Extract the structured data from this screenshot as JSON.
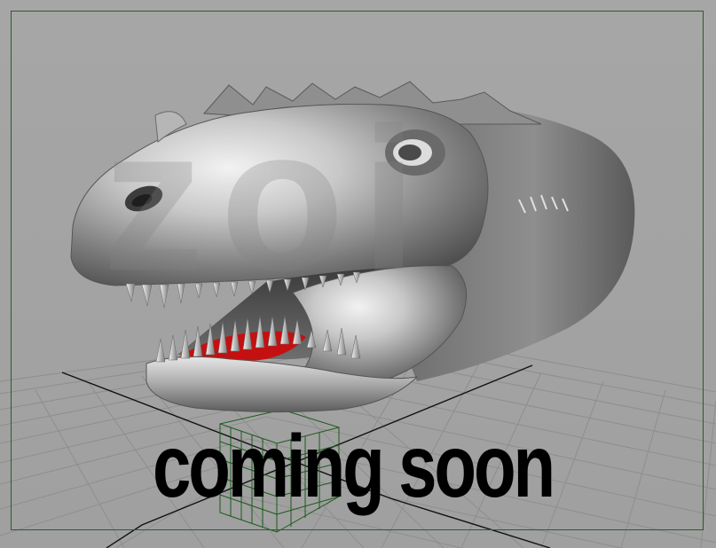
{
  "viewport": {
    "watermark_text": "zoi",
    "overlay_text": "coming soon",
    "colors": {
      "background": "#a3a3a3",
      "frame": "#2f5a2f",
      "grid": "#8e8e8e",
      "grid_axis": "#111111",
      "model_base": "#8a8a8a",
      "tongue": "#c41010",
      "selection_box": "#1a5a1a"
    },
    "model": "trex-head-icon",
    "object": "wireframe-cube-icon"
  }
}
